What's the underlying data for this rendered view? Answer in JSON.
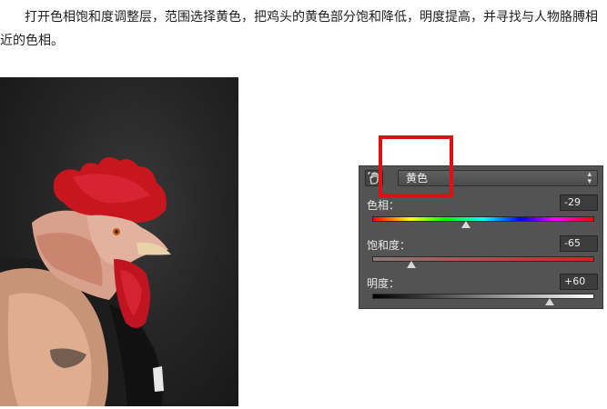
{
  "instruction_text": "打开色相饱和度调整层，范围选择黄色，把鸡头的黄色部分饱和降低，明度提高，并寻找与人物胳膊相近的色相。",
  "hue_saturation_panel": {
    "range_value": "黄色",
    "hue": {
      "label": "色相：",
      "value": "-29",
      "level": -29,
      "min": -180,
      "max": 180
    },
    "saturation": {
      "label": "饱和度：",
      "value": "-65",
      "level": -65,
      "min": -100,
      "max": 100
    },
    "lightness": {
      "label": "明度：",
      "value": "+60",
      "level": 60,
      "min": -100,
      "max": 100
    }
  },
  "colors": {
    "panel_bg": "#535353",
    "highlight_frame": "#e01010",
    "comb_red": "#c8161f"
  },
  "icons": {
    "hand_tool": "targeted-adjustment-hand-icon",
    "select_arrows": "up-down-arrows-icon"
  }
}
